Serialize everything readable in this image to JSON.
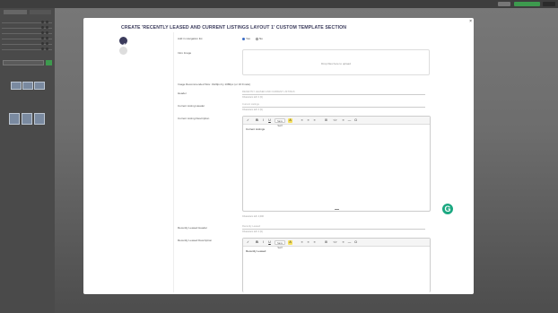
{
  "modal": {
    "title": "CREATE 'RECENTLY LEASED AND CURRENT LISTINGS LAYOUT 1' CUSTOM TEMPLATE SECTION",
    "close_icon": "×"
  },
  "form": {
    "nav_label": "Add in navigation list",
    "radio_yes": "Yes",
    "radio_no": "No",
    "intro_image_label": "Intro Image",
    "dropzone_text": "Drop files here to upload",
    "image_hint": "Image Recommended Size: 1920px by 1080px (or 16:9 ratio)",
    "header_label": "Header",
    "header_placeholder": "RECENTLY LEASED AND CURRENT LISTINGS",
    "header_chars": "Characters left: 0 (0)",
    "cl_header_label": "Current Listing Header",
    "cl_header_placeholder": "Current Listings",
    "cl_header_chars": "Characters left: 0 (0)",
    "cl_desc_label": "Current Listing Description",
    "cl_desc_text": "Current Listings",
    "cl_desc_chars": "Characters left: 2,000",
    "rl_header_label": "Recently Leased Header",
    "rl_header_placeholder": "Recently Leased",
    "rl_header_chars": "Characters left: 0 (0)",
    "rl_desc_label": "Recently Leased Description",
    "rl_desc_text": "Recently Leased"
  },
  "toolbar": {
    "items": [
      "✓",
      "B",
      "I",
      "U",
      "Sans Serif",
      "A",
      "≡",
      "≡",
      "≡",
      "⊞",
      "<>",
      "≡",
      "—",
      "Ω"
    ],
    "highlight_color": "#f6e05e"
  },
  "colors": {
    "step_active": "#3b3b5c",
    "step_inactive": "#dddddd",
    "topbar_btn_green": "#3d9a4e",
    "topbar_btn_dark": "#2b2b2b",
    "grammarly": "#1ba881"
  },
  "icons": {
    "grammarly_icon": "G",
    "pencil_icon": "pencil"
  }
}
